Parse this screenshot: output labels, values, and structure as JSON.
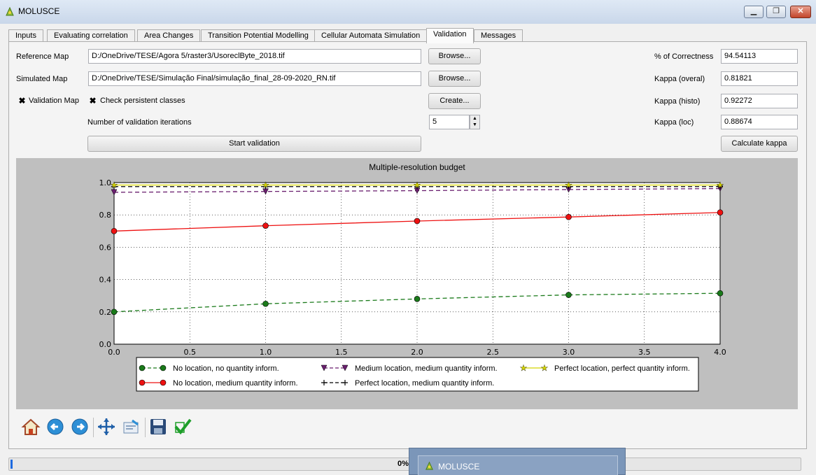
{
  "window": {
    "title": "MOLUSCE",
    "minimize_label": "▁",
    "restore_label": "❐",
    "close_label": "✕"
  },
  "tabs": [
    {
      "label": "Inputs"
    },
    {
      "label": "Evaluating correlation"
    },
    {
      "label": "Area Changes"
    },
    {
      "label": "Transition Potential Modelling"
    },
    {
      "label": "Cellular Automata Simulation"
    },
    {
      "label": "Validation"
    },
    {
      "label": "Messages"
    }
  ],
  "active_tab": "Validation",
  "validation": {
    "reference_map_label": "Reference Map",
    "reference_map_value": "D:/OneDrive/TESE/Agora 5/raster3/UsoreclByte_2018.tif",
    "simulated_map_label": "Simulated Map",
    "simulated_map_value": "D:/OneDrive/TESE/Simulação Final/simulação_final_28-09-2020_RN.tif",
    "browse_label": "Browse...",
    "create_label": "Create...",
    "validation_map_label": "Validation Map",
    "validation_map_checked": true,
    "persistent_label": "Check persistent classes",
    "persistent_checked": true,
    "iterations_label": "Number of validation iterations",
    "iterations_value": "5",
    "start_label": "Start validation",
    "correctness_label": "% of Correctness",
    "correctness_value": "94.54113",
    "kappa_overal_label": "Kappa (overal)",
    "kappa_overal_value": "0.81821",
    "kappa_histo_label": "Kappa (histo)",
    "kappa_histo_value": "0.92272",
    "kappa_loc_label": "Kappa (loc)",
    "kappa_loc_value": "0.88674",
    "calc_kappa_label": "Calculate kappa"
  },
  "chart_data": {
    "type": "line",
    "title": "Multiple-resolution budget",
    "xlim": [
      0.0,
      4.0
    ],
    "ylim": [
      0.0,
      1.0
    ],
    "x_ticks": [
      "0.0",
      "0.5",
      "1.0",
      "1.5",
      "2.0",
      "2.5",
      "3.0",
      "3.5",
      "4.0"
    ],
    "y_ticks": [
      "0.0",
      "0.2",
      "0.4",
      "0.6",
      "0.8",
      "1.0"
    ],
    "grid": true,
    "legend_position": "bottom",
    "x": [
      0,
      1,
      2,
      3,
      4
    ],
    "series": [
      {
        "name": "No location, no quantity inform.",
        "values": [
          0.2,
          0.25,
          0.28,
          0.305,
          0.315
        ],
        "color": "#1a7a1a",
        "dash": "dashed",
        "marker": "circle"
      },
      {
        "name": "No location, medium quantity inform.",
        "values": [
          0.7,
          0.733,
          0.762,
          0.787,
          0.815
        ],
        "color": "#e11",
        "dash": "solid",
        "marker": "circle"
      },
      {
        "name": "Medium location, medium quantity inform.",
        "values": [
          0.94,
          0.945,
          0.95,
          0.957,
          0.963
        ],
        "color": "#6a1f6f",
        "dash": "dashed",
        "marker": "triangle-down"
      },
      {
        "name": "Perfect location, medium quantity inform.",
        "values": [
          0.975,
          0.975,
          0.975,
          0.975,
          0.975
        ],
        "color": "#000000",
        "dash": "dashed",
        "marker": "plus"
      },
      {
        "name": "Perfect location, perfect quantity inform.",
        "values": [
          0.985,
          0.985,
          0.985,
          0.985,
          0.985
        ],
        "color": "#d4d400",
        "dash": "solid",
        "marker": "star"
      }
    ]
  },
  "progress": {
    "text": "0%",
    "value": 0
  },
  "popup": {
    "title": "MOLUSCE"
  },
  "toolbar_icons": [
    "home-icon",
    "back-icon",
    "forward-icon",
    "pan-icon",
    "configure-subplots-icon",
    "save-icon",
    "checkmark-icon"
  ]
}
